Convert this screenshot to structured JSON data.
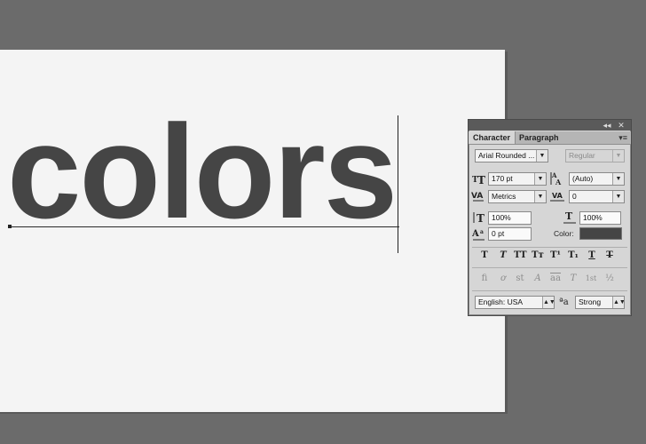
{
  "canvas": {
    "text": "colors"
  },
  "panel": {
    "top_buttons": [
      "◂◂",
      "✕"
    ],
    "tabs": [
      {
        "label": "Character"
      },
      {
        "label": "Paragraph"
      }
    ],
    "menu_icon": "▾≡",
    "font_family": "Arial Rounded ...",
    "font_style": "Regular",
    "font_size": "170 pt",
    "leading": "(Auto)",
    "kerning": "Metrics",
    "tracking": "0",
    "vertical_scale": "100%",
    "horizontal_scale": "100%",
    "baseline_shift": "0 pt",
    "color_label": "Color:",
    "color_value": "#454545",
    "type_buttons": [
      "T",
      "T",
      "TT",
      "Tт",
      "T¹",
      "T₁",
      "T",
      "T"
    ],
    "opentype_buttons": [
      "fi",
      "ơ",
      "st",
      "A",
      "aa",
      "T",
      "1st",
      "½"
    ],
    "language": "English: USA",
    "aa_icon": "ªa",
    "anti_alias": "Strong"
  },
  "icons": {
    "font_size_icon": "size",
    "leading_icon": "leading",
    "kerning_icon": "kerning",
    "tracking_icon": "tracking",
    "vscale_icon": "vscale",
    "hscale_icon": "hscale",
    "baseline_icon": "baseline"
  }
}
